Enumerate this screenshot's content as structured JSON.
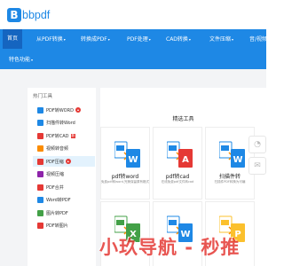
{
  "logo": {
    "mark": "B",
    "text": "bbpdf"
  },
  "nav": {
    "row1": [
      {
        "label": "首页",
        "active": true
      },
      {
        "label": "从PDF转换",
        "caret": true
      },
      {
        "label": "转换成PDF",
        "caret": true
      },
      {
        "label": "PDF处理",
        "caret": true
      },
      {
        "label": "CAD转换",
        "caret": true
      },
      {
        "label": "文件压缩",
        "caret": true
      },
      {
        "label": "音/视频",
        "caret": false
      }
    ],
    "row2": [
      {
        "label": "特色功能",
        "caret": true
      }
    ]
  },
  "sidebar": {
    "title": "热门工具",
    "items": [
      {
        "label": "PDF转WORD",
        "badge": "hot",
        "color": "#1e88e5"
      },
      {
        "label": "扫描件转Word",
        "color": "#1e88e5"
      },
      {
        "label": "PDF转CAD",
        "badge": "new",
        "badge_text": "新",
        "color": "#e53935"
      },
      {
        "label": "视频转音频",
        "color": "#fb8c00"
      },
      {
        "label": "PDF压缩",
        "badge": "hot",
        "color": "#e53935",
        "selected": true
      },
      {
        "label": "视频压缩",
        "color": "#8e24aa"
      },
      {
        "label": "PDF合并",
        "color": "#e53935"
      },
      {
        "label": "Word转PDF",
        "color": "#1e88e5"
      },
      {
        "label": "图片转PDF",
        "color": "#43a047"
      },
      {
        "label": "PDF转图片",
        "color": "#e53935"
      }
    ]
  },
  "content": {
    "title": "精选工具",
    "cards": [
      {
        "name": "pdf转word",
        "desc": "免费pdf转word,完美保留原有格式",
        "from": "#1e88e5",
        "to": "#1e88e5",
        "glyph": "W"
      },
      {
        "name": "pdf转cad",
        "desc": "在线免费pdf文件转cad",
        "from": "#1e88e5",
        "to": "#e53935",
        "glyph": "A"
      },
      {
        "name": "扫描件转",
        "desc": "扫描件PDF转换为可编",
        "from": "#1e88e5",
        "to": "#1e88e5",
        "glyph": "W"
      },
      {
        "name": "",
        "desc": "",
        "from": "#43a047",
        "to": "#43a047",
        "glyph": "X"
      },
      {
        "name": "",
        "desc": "",
        "from": "#1e88e5",
        "to": "#1e88e5",
        "glyph": "W"
      },
      {
        "name": "",
        "desc": "",
        "from": "#fbc02d",
        "to": "#fbc02d",
        "glyph": "P"
      }
    ]
  },
  "side_buttons": [
    "qq-icon",
    "chat-icon"
  ],
  "watermark": "小玖导航 - 秒推"
}
